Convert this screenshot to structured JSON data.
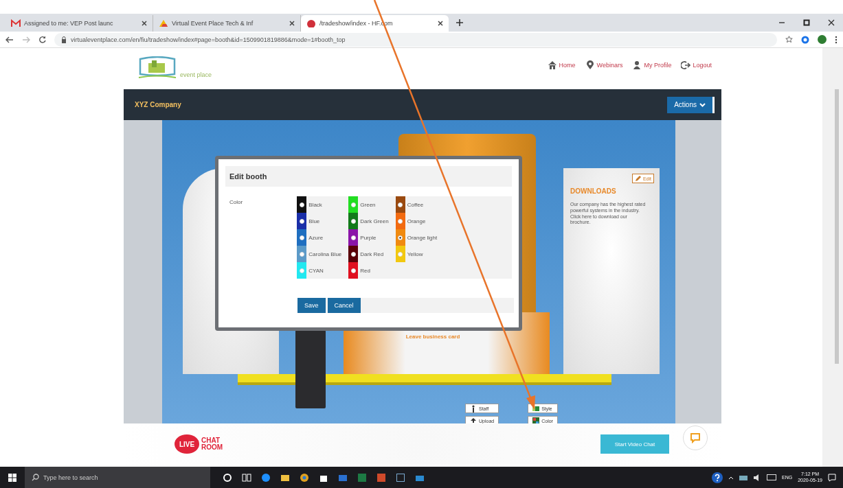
{
  "browser": {
    "tabs": [
      {
        "title": "Assigned to me: VEP Post launc",
        "selected": false,
        "kind": "mail"
      },
      {
        "title": "Virtual Event Place Tech & Inf",
        "selected": false,
        "kind": "drive"
      },
      {
        "title": "/tradeshow/index - HF.com",
        "selected": true,
        "kind": "site"
      }
    ],
    "url": "virtualeventplace.com/en/fiu/tradeshow/index#page=booth&id=1509901819886&mode=1#booth_top"
  },
  "site": {
    "logo_text": "event place",
    "nav": [
      {
        "label": "Home",
        "kind": "home"
      },
      {
        "label": "Webinars",
        "kind": "pin"
      },
      {
        "label": "My Profile",
        "kind": "user"
      },
      {
        "label": "Logout",
        "kind": "logout"
      }
    ],
    "company": "XYZ Company",
    "actions": "Actions"
  },
  "booth": {
    "downloads": {
      "title": "DOWNLOADS",
      "text": "Our company has the highest rated powerful systems in the industry. Click here to download our brochure.",
      "edit": "Edit"
    },
    "card_text": "Leave business card",
    "tools": [
      {
        "label": "Staff",
        "kind": "person"
      },
      {
        "label": "Style",
        "kind": "style"
      },
      {
        "label": "Upload",
        "kind": "upload"
      },
      {
        "label": "Color",
        "kind": "color"
      }
    ]
  },
  "modal": {
    "title": "Edit booth",
    "field_label": "Color",
    "colors": [
      {
        "label": "Black",
        "color": "#111111",
        "selected": false
      },
      {
        "label": "Blue",
        "color": "#1a2fa8",
        "selected": false
      },
      {
        "label": "Azure",
        "color": "#1f6fc0",
        "selected": false
      },
      {
        "label": "Carolina Blue",
        "color": "#5b9ac8",
        "selected": false
      },
      {
        "label": "CYAN",
        "color": "#22e8f0",
        "selected": false
      },
      {
        "label": "Green",
        "color": "#22dd22",
        "selected": false
      },
      {
        "label": "Dark Green",
        "color": "#127a1a",
        "selected": false
      },
      {
        "label": "Purple",
        "color": "#8a14a8",
        "selected": false
      },
      {
        "label": "Dark Red",
        "color": "#5a0008",
        "selected": false
      },
      {
        "label": "Red",
        "color": "#e01020",
        "selected": false
      },
      {
        "label": "Coffee",
        "color": "#9a4a10",
        "selected": false
      },
      {
        "label": "Orange",
        "color": "#f26a10",
        "selected": false
      },
      {
        "label": "Orange light",
        "color": "#f08a10",
        "selected": true
      },
      {
        "label": "Yellow",
        "color": "#f2c810",
        "selected": false
      }
    ],
    "buttons": [
      "Save",
      "Cancel"
    ]
  },
  "footer": {
    "badge": "LIVE",
    "chat_lines": [
      "CHAT",
      "ROOM"
    ],
    "video_button": "Start Video Chat"
  },
  "taskbar": {
    "search_placeholder": "Type here to search",
    "language": "ENG",
    "time": "7:12 PM",
    "date": "2020-05-19"
  }
}
